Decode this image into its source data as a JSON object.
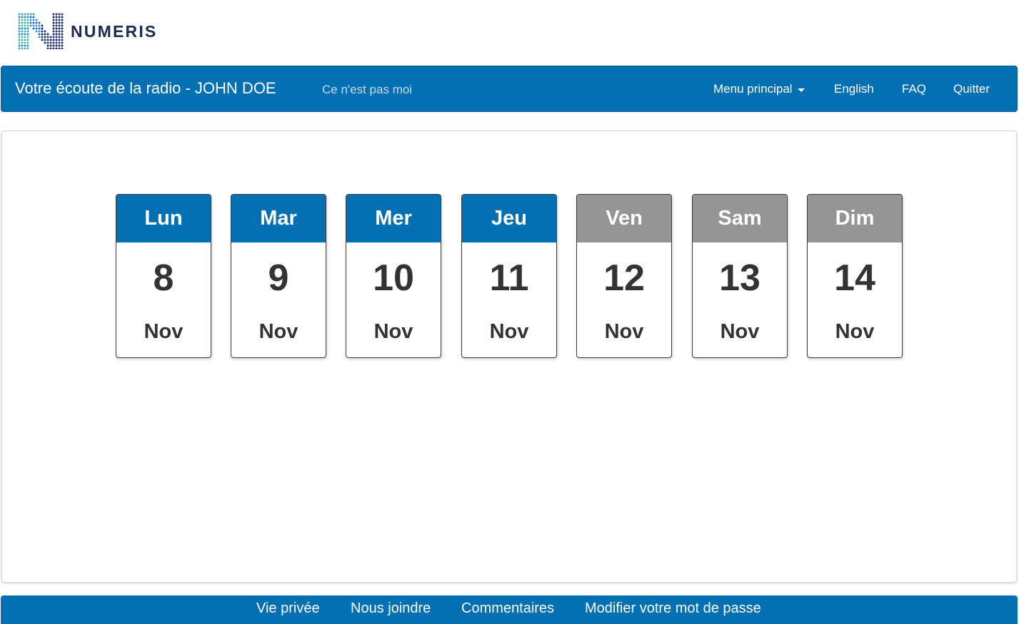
{
  "brand": {
    "name": "NUMERIS"
  },
  "nav": {
    "title": "Votre écoute de la radio - JOHN DOE",
    "not_me": "Ce n'est pas moi",
    "menu_label": "Menu principal",
    "english": "English",
    "faq": "FAQ",
    "quit": "Quitter"
  },
  "days": [
    {
      "name": "Lun",
      "date": "8",
      "month": "Nov",
      "status": "active"
    },
    {
      "name": "Mar",
      "date": "9",
      "month": "Nov",
      "status": "active"
    },
    {
      "name": "Mer",
      "date": "10",
      "month": "Nov",
      "status": "active"
    },
    {
      "name": "Jeu",
      "date": "11",
      "month": "Nov",
      "status": "active"
    },
    {
      "name": "Ven",
      "date": "12",
      "month": "Nov",
      "status": "inactive"
    },
    {
      "name": "Sam",
      "date": "13",
      "month": "Nov",
      "status": "inactive"
    },
    {
      "name": "Dim",
      "date": "14",
      "month": "Nov",
      "status": "inactive"
    }
  ],
  "footer": {
    "privacy": "Vie privée",
    "contact": "Nous joindre",
    "comments": "Commentaires",
    "change_password": "Modifier votre mot de passe"
  },
  "colors": {
    "brand_blue": "#0470b4",
    "inactive_gray": "#959595",
    "logo_navy": "#1c2a52"
  }
}
